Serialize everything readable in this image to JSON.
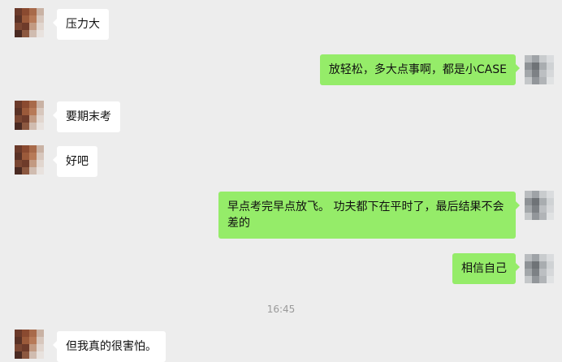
{
  "timestamp": "16:45",
  "messages": [
    {
      "side": "in",
      "text": "压力大"
    },
    {
      "side": "out",
      "text": "放轻松，多大点事啊，都是小CASE"
    },
    {
      "side": "in",
      "text": "要期末考"
    },
    {
      "side": "in",
      "text": "好吧"
    },
    {
      "side": "out",
      "text": "早点考完早点放飞。 功夫都下在平时了，最后结果不会差的"
    },
    {
      "side": "out",
      "text": "相信自己"
    },
    {
      "side": "in",
      "text": "但我真的很害怕。"
    }
  ],
  "colors": {
    "background": "#ededed",
    "incoming_bubble": "#ffffff",
    "outgoing_bubble": "#95ec69",
    "timestamp_text": "#9a9a9a"
  }
}
